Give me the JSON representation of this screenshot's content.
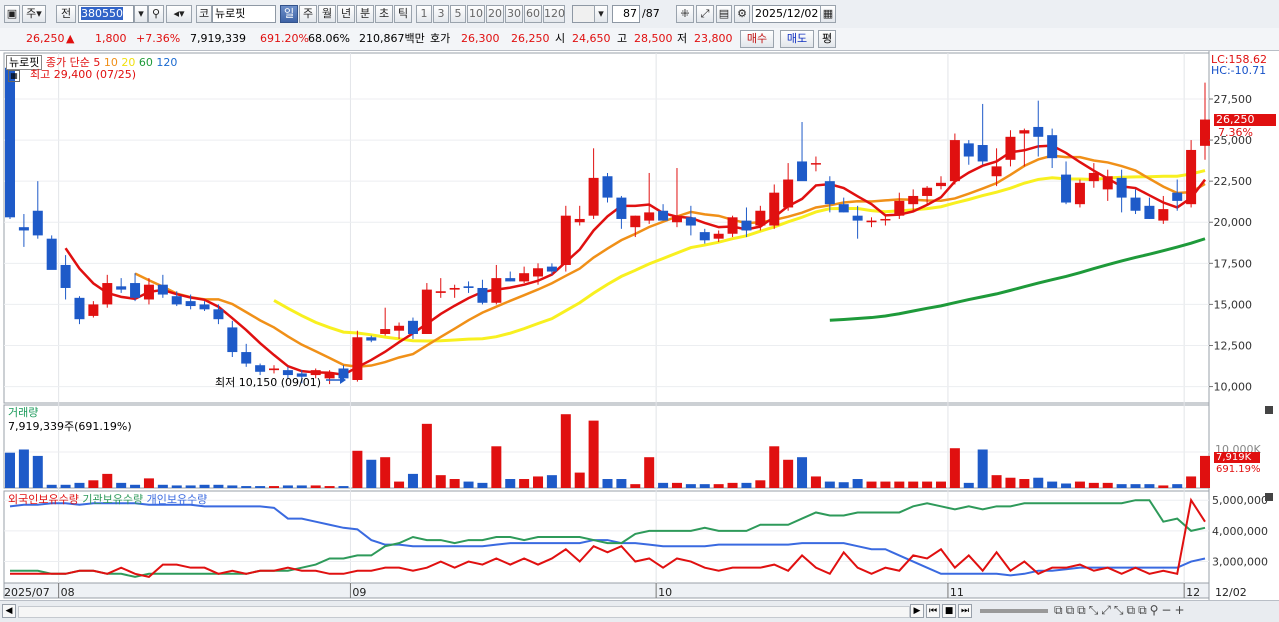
{
  "toolbar": {
    "market_label": "주",
    "prev_label": "전",
    "code_value": "380550",
    "stock_name_prefix": "코",
    "stock_name": "뉴로핏",
    "period_tabs": [
      "일",
      "주",
      "월",
      "년",
      "분",
      "초",
      "틱"
    ],
    "active_period": "일",
    "number_tabs": [
      "1",
      "3",
      "5",
      "10",
      "20",
      "30",
      "60",
      "120"
    ],
    "count_value": "87",
    "count_total": "/87",
    "date_value": "2025/12/02"
  },
  "quote": {
    "price": "26,250",
    "change_arrow": "▲",
    "change": "1,800",
    "change_pct": "+7.36%",
    "volume": "7,919,339",
    "volume_pct": "691.20%",
    "turnover_pct": "68.06%",
    "amount": "210,867백만",
    "bid_label": "호가",
    "bid1": "26,300",
    "bid2": "26,250",
    "open_label": "시",
    "open": "24,650",
    "high_label": "고",
    "high": "28,500",
    "low_label": "저",
    "low": "23,800",
    "buy_label": "매수",
    "sell_label": "매도",
    "eval_label": "평"
  },
  "price_panel": {
    "name_tag": "뉴로핏",
    "ma_title": "종가 단순",
    "ma_periods": [
      "5",
      "10",
      "20",
      "60",
      "120"
    ],
    "ma_colors": [
      "#e01010",
      "#f09018",
      "#f0e010",
      "#1e9a3a",
      "#1a6ad0"
    ],
    "high_note": "최고 29,400 (07/25)",
    "low_note": "최저 10,150 (09/01)",
    "lc": "LC:158.62",
    "hc": "HC:-10.71",
    "current_tag": "26,250",
    "current_pct": "7.36%",
    "y_ticks": [
      "27,500",
      "25,000",
      "22,500",
      "20,000",
      "17,500",
      "15,000",
      "12,500",
      "10,000"
    ]
  },
  "volume_panel": {
    "title": "거래량",
    "value_note": "7,919,339주(691.19%)",
    "y_tick": "10,000K",
    "current_tag": "7,919K",
    "current_pct": "691.19%"
  },
  "holdings_panel": {
    "legend": [
      "외국인보유수량",
      "기관보유수량",
      "개인보유수량"
    ],
    "y_ticks": [
      "5,000,000",
      "4,000,000",
      "3,000,000"
    ]
  },
  "x_axis": {
    "labels": [
      "2025/07",
      "08",
      "09",
      "10",
      "11",
      "12",
      "12/02"
    ]
  },
  "colors": {
    "up": "#e01010",
    "down": "#1e5ac8",
    "ma5": "#e01010",
    "ma10": "#f09018",
    "ma20": "#f8f020",
    "ma60": "#1e9a3a",
    "foreign": "#e01010",
    "institution": "#2e9a5a",
    "individual": "#3a6ae0"
  },
  "chart_data": {
    "type": "candlestick",
    "dates_note": "daily candles 2025/07/24 to 2025/12/02",
    "candles": [
      {
        "o": 29400,
        "h": 29400,
        "l": 20200,
        "c": 20300
      },
      {
        "o": 19700,
        "h": 20500,
        "l": 18500,
        "c": 19500
      },
      {
        "o": 20700,
        "h": 22500,
        "l": 19000,
        "c": 19200
      },
      {
        "o": 19000,
        "h": 19200,
        "l": 17500,
        "c": 17100
      },
      {
        "o": 17400,
        "h": 18000,
        "l": 15300,
        "c": 16000
      },
      {
        "o": 15400,
        "h": 15500,
        "l": 13800,
        "c": 14100
      },
      {
        "o": 14300,
        "h": 15200,
        "l": 14200,
        "c": 15000
      },
      {
        "o": 15000,
        "h": 16800,
        "l": 14800,
        "c": 16300
      },
      {
        "o": 16100,
        "h": 16600,
        "l": 15700,
        "c": 15900
      },
      {
        "o": 16300,
        "h": 16900,
        "l": 15200,
        "c": 15400
      },
      {
        "o": 15300,
        "h": 16600,
        "l": 15000,
        "c": 16200
      },
      {
        "o": 16200,
        "h": 16800,
        "l": 15400,
        "c": 15600
      },
      {
        "o": 15500,
        "h": 15800,
        "l": 14900,
        "c": 15000
      },
      {
        "o": 15200,
        "h": 15600,
        "l": 14700,
        "c": 14900
      },
      {
        "o": 15000,
        "h": 15200,
        "l": 14600,
        "c": 14700
      },
      {
        "o": 14700,
        "h": 15000,
        "l": 13800,
        "c": 14100
      },
      {
        "o": 13600,
        "h": 14000,
        "l": 11800,
        "c": 12100
      },
      {
        "o": 12100,
        "h": 12600,
        "l": 11200,
        "c": 11400
      },
      {
        "o": 11300,
        "h": 11400,
        "l": 10700,
        "c": 10900
      },
      {
        "o": 11000,
        "h": 11300,
        "l": 10800,
        "c": 11100
      },
      {
        "o": 11000,
        "h": 11200,
        "l": 10500,
        "c": 10700
      },
      {
        "o": 10800,
        "h": 11000,
        "l": 10200,
        "c": 10600
      },
      {
        "o": 10700,
        "h": 11100,
        "l": 10500,
        "c": 11000
      },
      {
        "o": 10500,
        "h": 11000,
        "l": 10150,
        "c": 10800
      },
      {
        "o": 11100,
        "h": 11300,
        "l": 10400,
        "c": 10500
      },
      {
        "o": 10400,
        "h": 13400,
        "l": 10300,
        "c": 13000
      },
      {
        "o": 13000,
        "h": 13100,
        "l": 12700,
        "c": 12800
      },
      {
        "o": 13200,
        "h": 14800,
        "l": 13100,
        "c": 13500
      },
      {
        "o": 13400,
        "h": 13900,
        "l": 12900,
        "c": 13700
      },
      {
        "o": 14000,
        "h": 14200,
        "l": 12900,
        "c": 13200
      },
      {
        "o": 13200,
        "h": 16300,
        "l": 13200,
        "c": 15900
      },
      {
        "o": 15700,
        "h": 16600,
        "l": 15400,
        "c": 15800
      },
      {
        "o": 15900,
        "h": 16200,
        "l": 15400,
        "c": 16000
      },
      {
        "o": 16100,
        "h": 16400,
        "l": 15700,
        "c": 16000
      },
      {
        "o": 16000,
        "h": 16500,
        "l": 15000,
        "c": 15100
      },
      {
        "o": 15100,
        "h": 17400,
        "l": 15000,
        "c": 16600
      },
      {
        "o": 16600,
        "h": 17000,
        "l": 16400,
        "c": 16400
      },
      {
        "o": 16400,
        "h": 17300,
        "l": 16300,
        "c": 16900
      },
      {
        "o": 16700,
        "h": 17500,
        "l": 16200,
        "c": 17200
      },
      {
        "o": 17300,
        "h": 17500,
        "l": 16800,
        "c": 17000
      },
      {
        "o": 17400,
        "h": 21000,
        "l": 17000,
        "c": 20400
      },
      {
        "o": 20000,
        "h": 21000,
        "l": 19800,
        "c": 20200
      },
      {
        "o": 20400,
        "h": 24500,
        "l": 20200,
        "c": 22700
      },
      {
        "o": 22800,
        "h": 23000,
        "l": 21200,
        "c": 21500
      },
      {
        "o": 21500,
        "h": 21600,
        "l": 19600,
        "c": 20200
      },
      {
        "o": 19700,
        "h": 20400,
        "l": 19100,
        "c": 20400
      },
      {
        "o": 20100,
        "h": 23000,
        "l": 19900,
        "c": 20600
      },
      {
        "o": 20700,
        "h": 21100,
        "l": 20100,
        "c": 20100
      },
      {
        "o": 20000,
        "h": 23300,
        "l": 19700,
        "c": 20400
      },
      {
        "o": 20300,
        "h": 21000,
        "l": 19200,
        "c": 19800
      },
      {
        "o": 19400,
        "h": 19600,
        "l": 18700,
        "c": 18900
      },
      {
        "o": 19000,
        "h": 19500,
        "l": 18800,
        "c": 19300
      },
      {
        "o": 19300,
        "h": 20400,
        "l": 19100,
        "c": 20300
      },
      {
        "o": 20100,
        "h": 20900,
        "l": 19100,
        "c": 19500
      },
      {
        "o": 19800,
        "h": 21000,
        "l": 19500,
        "c": 20700
      },
      {
        "o": 19800,
        "h": 22300,
        "l": 19600,
        "c": 21800
      },
      {
        "o": 20900,
        "h": 23600,
        "l": 20700,
        "c": 22600
      },
      {
        "o": 23700,
        "h": 26100,
        "l": 22600,
        "c": 22500
      },
      {
        "o": 23600,
        "h": 24000,
        "l": 23100,
        "c": 23600
      },
      {
        "o": 22500,
        "h": 22800,
        "l": 20600,
        "c": 21100
      },
      {
        "o": 21100,
        "h": 21500,
        "l": 20600,
        "c": 20600
      },
      {
        "o": 20400,
        "h": 21000,
        "l": 19000,
        "c": 20100
      },
      {
        "o": 20000,
        "h": 20300,
        "l": 19700,
        "c": 20100
      },
      {
        "o": 20200,
        "h": 20500,
        "l": 19800,
        "c": 20200
      },
      {
        "o": 20400,
        "h": 21800,
        "l": 20200,
        "c": 21300
      },
      {
        "o": 21100,
        "h": 22000,
        "l": 20600,
        "c": 21600
      },
      {
        "o": 21600,
        "h": 22200,
        "l": 21100,
        "c": 22100
      },
      {
        "o": 22200,
        "h": 22800,
        "l": 22000,
        "c": 22400
      },
      {
        "o": 22500,
        "h": 25400,
        "l": 22300,
        "c": 25000
      },
      {
        "o": 24800,
        "h": 25000,
        "l": 23500,
        "c": 24000
      },
      {
        "o": 24700,
        "h": 27200,
        "l": 23500,
        "c": 23700
      },
      {
        "o": 22800,
        "h": 24500,
        "l": 22200,
        "c": 23400
      },
      {
        "o": 23800,
        "h": 25600,
        "l": 23400,
        "c": 25200
      },
      {
        "o": 25400,
        "h": 25700,
        "l": 23400,
        "c": 25600
      },
      {
        "o": 25800,
        "h": 27400,
        "l": 24000,
        "c": 25200
      },
      {
        "o": 25300,
        "h": 25700,
        "l": 23300,
        "c": 23900
      },
      {
        "o": 22900,
        "h": 23700,
        "l": 21100,
        "c": 21200
      },
      {
        "o": 21100,
        "h": 22600,
        "l": 20900,
        "c": 22400
      },
      {
        "o": 22500,
        "h": 23600,
        "l": 22100,
        "c": 23000
      },
      {
        "o": 22000,
        "h": 23200,
        "l": 21300,
        "c": 22800
      },
      {
        "o": 22700,
        "h": 23200,
        "l": 20600,
        "c": 21500
      },
      {
        "o": 21500,
        "h": 22000,
        "l": 20500,
        "c": 20700
      },
      {
        "o": 21000,
        "h": 21500,
        "l": 20200,
        "c": 20200
      },
      {
        "o": 20100,
        "h": 21600,
        "l": 19900,
        "c": 20800
      },
      {
        "o": 21800,
        "h": 22600,
        "l": 20700,
        "c": 21300
      },
      {
        "o": 21100,
        "h": 25000,
        "l": 20900,
        "c": 24400
      },
      {
        "o": 24650,
        "h": 28500,
        "l": 23800,
        "c": 26250
      }
    ],
    "volume": [
      55,
      60,
      50,
      5,
      5,
      8,
      12,
      22,
      8,
      5,
      15,
      5,
      4,
      4,
      5,
      5,
      4,
      3,
      3,
      3,
      4,
      4,
      4,
      3,
      3,
      58,
      44,
      48,
      10,
      22,
      100,
      20,
      14,
      10,
      8,
      65,
      14,
      14,
      18,
      20,
      115,
      24,
      105,
      14,
      14,
      6,
      48,
      8,
      8,
      6,
      6,
      6,
      8,
      8,
      12,
      65,
      44,
      48,
      18,
      10,
      9,
      14,
      10,
      10,
      10,
      10,
      10,
      10,
      62,
      8,
      60,
      20,
      16,
      14,
      16,
      10,
      7,
      10,
      8,
      8,
      6,
      6,
      6,
      4,
      6,
      18,
      50
    ],
    "ma60_start_index": 59,
    "holdings": {
      "foreign": [
        2.6,
        2.6,
        2.6,
        2.6,
        2.6,
        2.7,
        2.7,
        2.6,
        2.8,
        2.6,
        2.5,
        2.9,
        2.9,
        2.8,
        2.8,
        2.6,
        2.7,
        2.6,
        2.7,
        2.7,
        2.8,
        2.7,
        2.7,
        2.6,
        2.6,
        2.7,
        2.7,
        2.8,
        2.8,
        2.7,
        2.8,
        3.0,
        2.8,
        3.0,
        2.9,
        3.1,
        2.9,
        3.1,
        2.9,
        3.1,
        3.4,
        3.0,
        3.5,
        3.3,
        3.5,
        3.0,
        3.1,
        2.8,
        3.1,
        3.0,
        2.8,
        2.7,
        2.8,
        2.8,
        2.8,
        2.9,
        2.7,
        3.2,
        2.8,
        2.6,
        3.3,
        2.8,
        2.6,
        2.8,
        2.7,
        3.2,
        3.1,
        3.4,
        2.8,
        3.2,
        2.7,
        3.3,
        2.7,
        3.0,
        2.6,
        2.8,
        2.8,
        2.9,
        2.7,
        2.8,
        2.6,
        2.8,
        2.6,
        2.7,
        2.6,
        5.0,
        4.3
      ],
      "institution": [
        2.7,
        2.7,
        2.7,
        2.6,
        2.6,
        2.7,
        2.7,
        2.6,
        2.6,
        2.5,
        2.6,
        2.6,
        2.6,
        2.6,
        2.6,
        2.6,
        2.6,
        2.6,
        2.7,
        2.7,
        2.7,
        2.8,
        2.9,
        3.1,
        3.1,
        3.2,
        3.2,
        3.5,
        3.6,
        3.8,
        3.7,
        3.7,
        3.6,
        3.7,
        3.7,
        3.8,
        3.8,
        3.7,
        3.8,
        3.8,
        3.8,
        3.8,
        3.7,
        3.6,
        3.6,
        3.9,
        4.0,
        4.0,
        4.0,
        4.0,
        4.1,
        4.0,
        4.0,
        4.0,
        4.2,
        4.2,
        4.2,
        4.4,
        4.6,
        4.5,
        4.5,
        4.6,
        4.6,
        4.6,
        4.6,
        4.8,
        4.9,
        4.8,
        4.7,
        4.8,
        4.7,
        4.8,
        4.8,
        4.9,
        4.9,
        4.9,
        4.9,
        4.9,
        4.9,
        4.9,
        4.9,
        5.0,
        5.0,
        4.3,
        4.4,
        4.0,
        4.1
      ],
      "individual": [
        4.8,
        4.85,
        4.85,
        4.9,
        4.9,
        4.85,
        4.9,
        4.9,
        4.9,
        4.9,
        4.85,
        4.85,
        4.85,
        4.85,
        4.8,
        4.8,
        4.8,
        4.8,
        4.8,
        4.75,
        4.4,
        4.4,
        4.3,
        4.2,
        4.1,
        4.05,
        3.7,
        3.55,
        3.55,
        3.5,
        3.5,
        3.5,
        3.5,
        3.5,
        3.5,
        3.55,
        3.6,
        3.6,
        3.6,
        3.6,
        3.6,
        3.6,
        3.7,
        3.7,
        3.6,
        3.6,
        3.55,
        3.5,
        3.5,
        3.5,
        3.5,
        3.55,
        3.55,
        3.55,
        3.55,
        3.55,
        3.55,
        3.6,
        3.6,
        3.6,
        3.6,
        3.5,
        3.4,
        3.4,
        3.2,
        3.0,
        2.8,
        2.6,
        2.6,
        2.6,
        2.6,
        2.6,
        2.55,
        2.6,
        2.7,
        2.7,
        2.75,
        2.8,
        2.8,
        2.8,
        2.8,
        2.8,
        2.8,
        2.8,
        2.8,
        3.0,
        3.1
      ]
    },
    "y_range_price": [
      9000,
      30300
    ],
    "y_range_holdings": [
      2.3,
      5.3
    ]
  }
}
